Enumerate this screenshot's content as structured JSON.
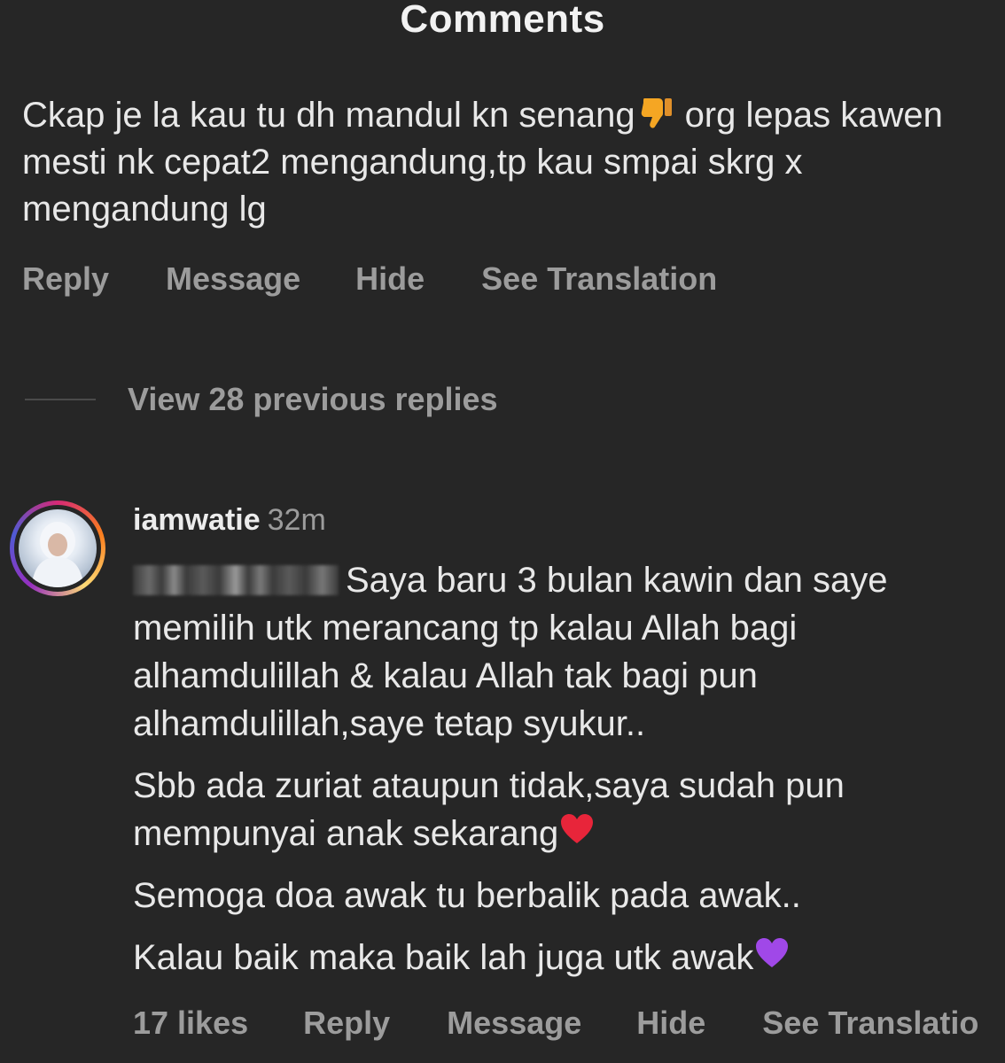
{
  "header": {
    "title": "Comments"
  },
  "comment": {
    "text_before_emoji": "Ckap je la kau tu dh mandul kn senang",
    "emoji": "thumbs-down",
    "text_after_emoji": "org lepas kawen mesti nk cepat2 mengandung,tp kau smpai skrg x mengandung lg",
    "actions": {
      "reply": "Reply",
      "message": "Message",
      "hide": "Hide",
      "see_translation": "See Translation"
    }
  },
  "view_replies": {
    "label": "View 28 previous replies"
  },
  "reply": {
    "username": "iamwatie",
    "time": "32m",
    "mention_redacted": true,
    "paragraphs": [
      "Saya baru 3 bulan kawin dan saye memilih utk merancang tp kalau Allah bagi alhamdulillah & kalau Allah tak bagi pun alhamdulillah,saye tetap syukur..",
      "Sbb ada zuriat ataupun tidak,saya sudah pun mempunyai anak sekarang",
      "Semoga doa awak tu berbalik pada awak..",
      "Kalau baik maka baik lah juga utk awak"
    ],
    "paragraph_emojis": [
      "",
      "red-heart",
      "",
      "purple-heart"
    ],
    "actions": {
      "likes": "17 likes",
      "reply": "Reply",
      "message": "Message",
      "hide": "Hide",
      "see_translation": "See Translatio"
    }
  },
  "colors": {
    "background": "#262626",
    "primary_text": "#e8e8e8",
    "secondary_text": "#9c9c9c",
    "thumbs_emoji": "#f5a623",
    "heart_red": "#e8253a",
    "heart_purple": "#a048e8"
  }
}
